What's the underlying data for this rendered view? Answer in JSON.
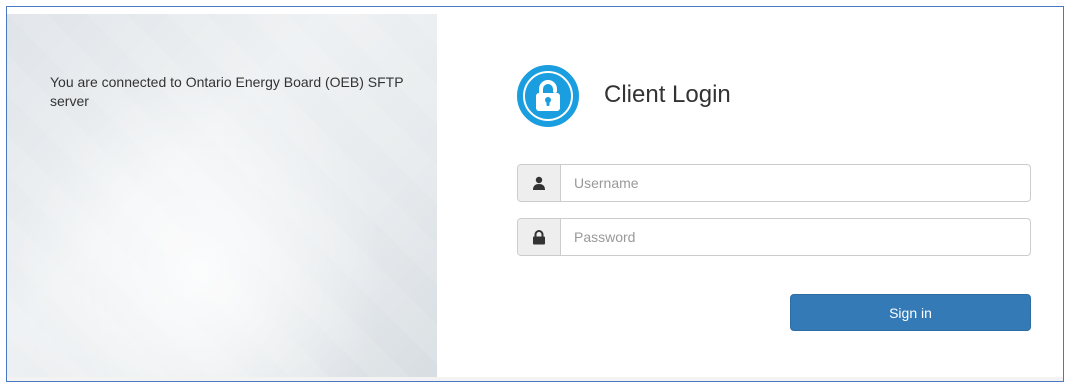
{
  "left_panel": {
    "message": "You are connected to Ontario Energy Board (OEB) SFTP server"
  },
  "login": {
    "title": "Client Login",
    "logo_icon": "padlock-icon",
    "username": {
      "icon": "user-icon",
      "placeholder": "Username",
      "value": ""
    },
    "password": {
      "icon": "lock-icon",
      "placeholder": "Password",
      "value": ""
    },
    "sign_in_label": "Sign in"
  },
  "colors": {
    "accent": "#1a9ee0",
    "button": "#337ab7",
    "frame_border": "#4a78c2"
  }
}
